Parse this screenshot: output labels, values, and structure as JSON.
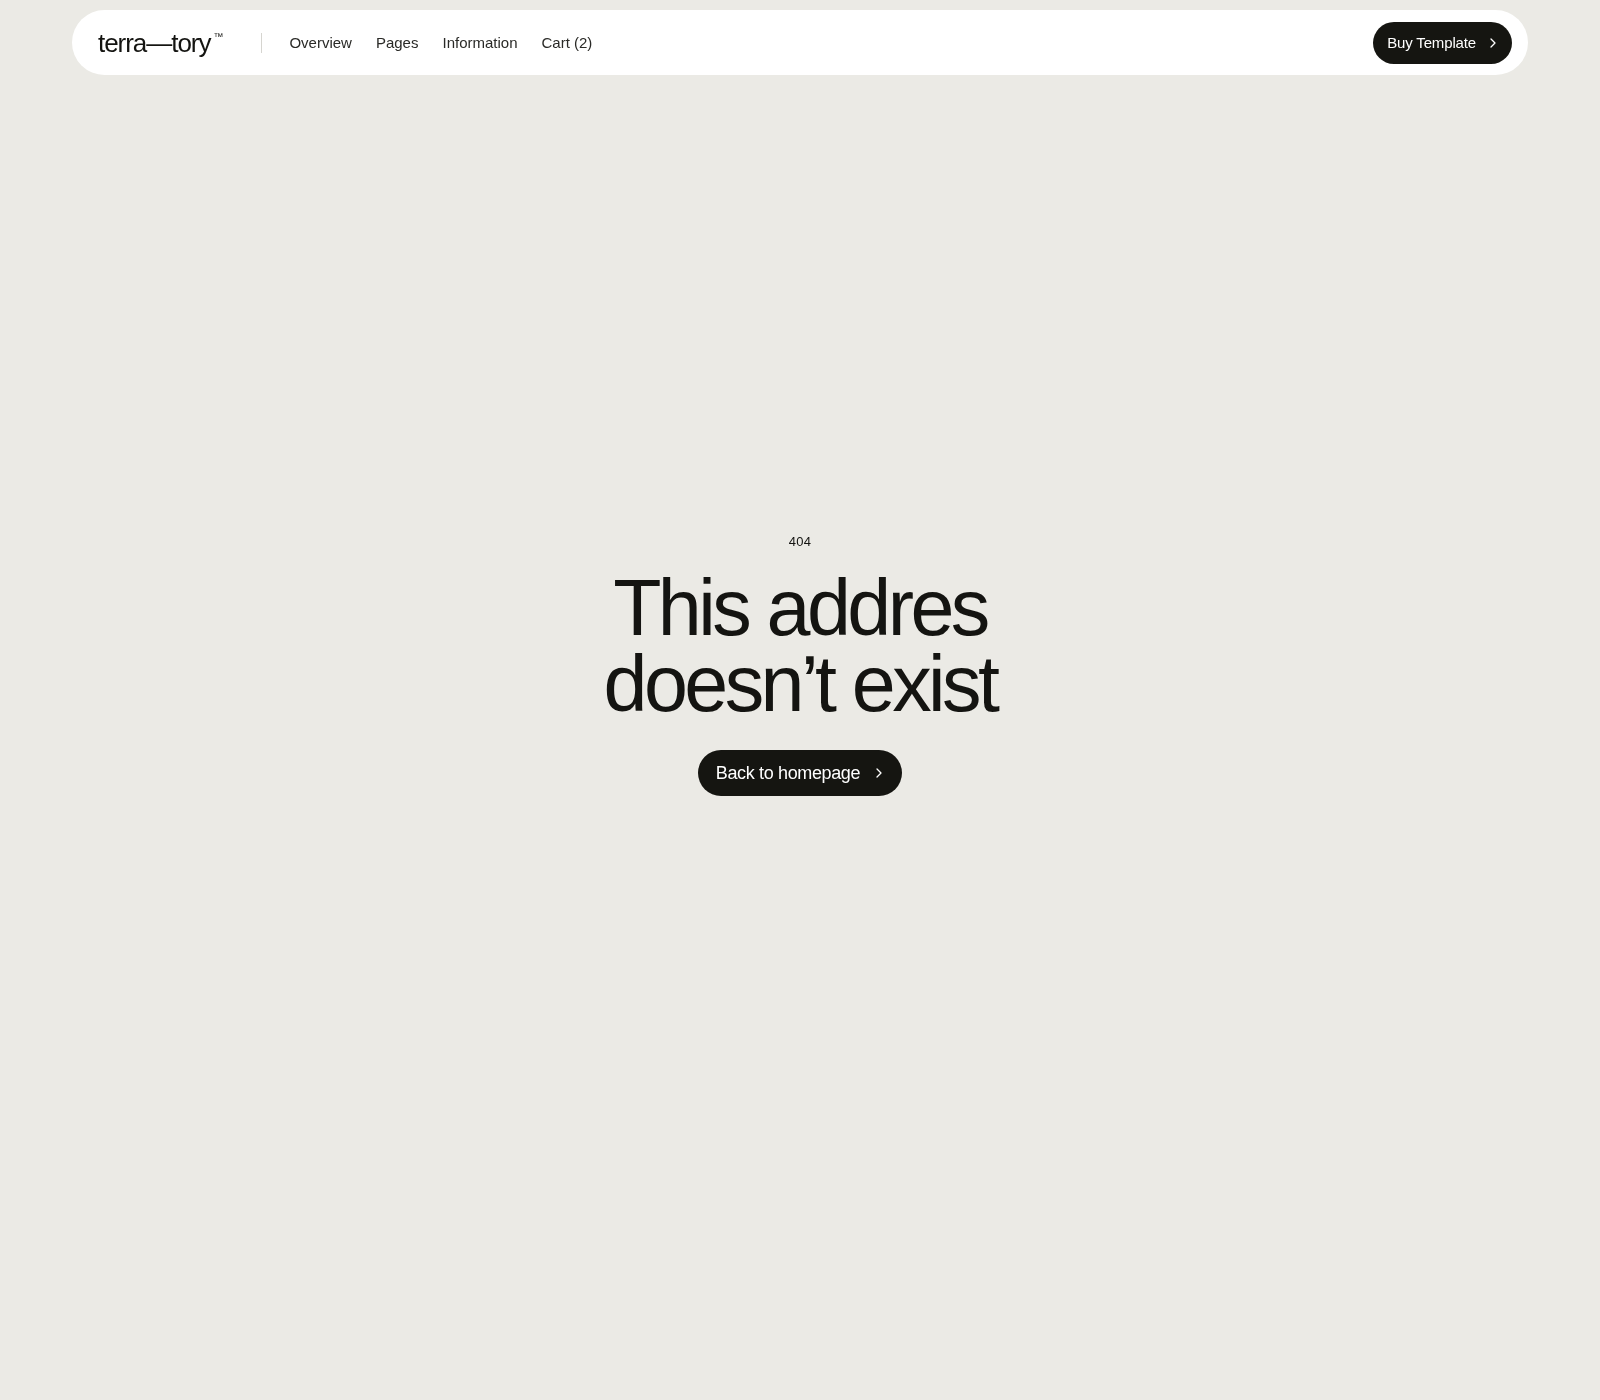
{
  "nav": {
    "logo": "terra—tory$^{™}$",
    "links": [
      {
        "label": "Overview"
      },
      {
        "label": "Pages"
      },
      {
        "label": "Information"
      },
      {
        "label": "Cart (2)"
      }
    ],
    "cta": {
      "label": "Buy Template"
    }
  },
  "error": {
    "code": "404",
    "heading": [
      "This addres",
      "doesn’t exist"
    ],
    "button": {
      "label": "Back to homepage"
    }
  }
}
